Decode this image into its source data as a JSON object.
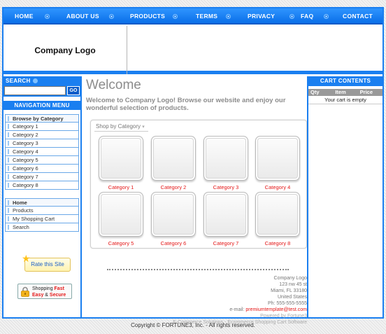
{
  "topnav": {
    "items": [
      "HOME",
      "ABOUT US",
      "PRODUCTS",
      "TERMS",
      "PRIVACY",
      "FAQ",
      "CONTACT"
    ]
  },
  "header": {
    "logo_text": "Company Logo"
  },
  "sidebar": {
    "search_title": "SEARCH",
    "search_value": "",
    "go_label": "GO",
    "nav_title": "NAVIGATION MENU",
    "categories_heading": "Browse by Category",
    "categories": [
      "Category 1",
      "Category 2",
      "Category 3",
      "Category 4",
      "Category 5",
      "Category 6",
      "Category 7",
      "Category 8"
    ],
    "links": [
      "Home",
      "Products",
      "My Shopping Cart",
      "Search"
    ],
    "rate_label": "Rate this Site",
    "secure_line1": "Shopping ",
    "secure_fast": "Fast",
    "secure_line2a": "Easy",
    "secure_amp": " & ",
    "secure_line2b": "Secure"
  },
  "main": {
    "title": "Welcome",
    "intro": "Welcome to  Company Logo! Browse our website and enjoy our wonderful selection of products.",
    "shop_tab": "Shop by Category",
    "categories": [
      "Category 1",
      "Category 2",
      "Category 3",
      "Category 4",
      "Category 5",
      "Category 6",
      "Category 7",
      "Category 8"
    ]
  },
  "footer": {
    "company": "Company Logo",
    "street": "123 nw 45 st",
    "city": "Miami, FL 33180",
    "country": "United States",
    "phone": "Ph: 555-555-5555",
    "email_label": "e-mail: ",
    "email": "premiumtemplate@test.com",
    "powered": "Powered by Fortune3",
    "software": "E-Commerce Solutions - Ecommerce Shopping Cart Software",
    "copyright": "Copyright © FORTUNE3, Inc. - All rights reserved."
  },
  "cart": {
    "title": "CART CONTENTS",
    "columns": [
      "Qty",
      "Item",
      "Price"
    ],
    "empty_text": "Your cart is empty"
  },
  "colors": {
    "accent": "#1a7ff0",
    "link_red": "#e41818",
    "heading_gray": "#8c8c8c"
  }
}
